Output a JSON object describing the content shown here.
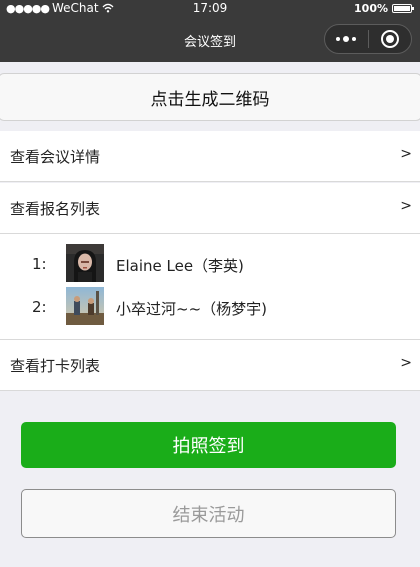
{
  "status_bar": {
    "signal": "●●●●●",
    "carrier": "WeChat",
    "time": "17:09",
    "battery": "100%"
  },
  "nav": {
    "title": "会议签到",
    "more_icon": "more-dots-icon",
    "close_icon": "target-circle-icon"
  },
  "qr_button": {
    "label": "点击生成二维码"
  },
  "meeting_details": {
    "label": "查看会议详情",
    "chevron": ">"
  },
  "signup_list": {
    "label": "查看报名列表",
    "chevron": ">",
    "participants": [
      {
        "index": "1:",
        "name": "Elaine Lee（李英)"
      },
      {
        "index": "2:",
        "name": "小卒过河~~（杨梦宇)"
      }
    ]
  },
  "checkin_list": {
    "label": "查看打卡列表",
    "chevron": ">"
  },
  "checkin_button": {
    "label": "拍照签到"
  },
  "end_button": {
    "label": "结束活动"
  },
  "colors": {
    "nav_bg": "#3a3a3a",
    "primary_green": "#1aad19",
    "page_bg": "#efeff4"
  }
}
